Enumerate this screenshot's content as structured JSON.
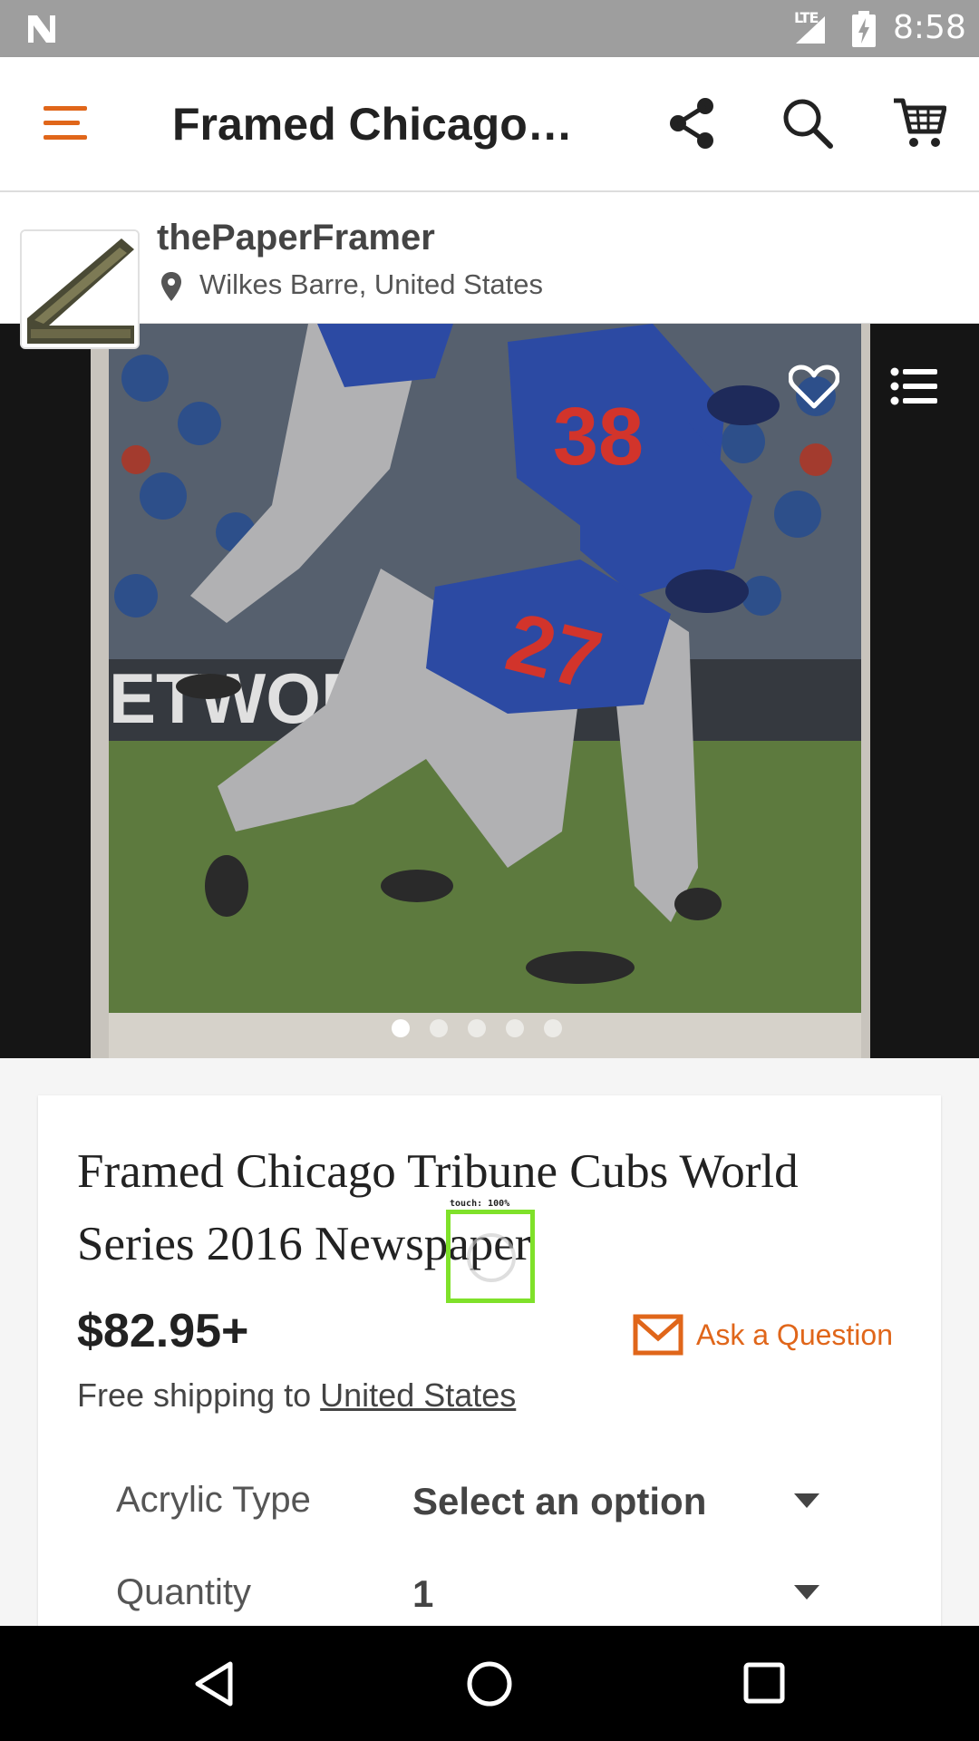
{
  "status_bar": {
    "time": "8:58",
    "network": "LTE"
  },
  "app_bar": {
    "title": "Framed Chicago…",
    "icons": [
      "menu-icon",
      "share-icon",
      "search-icon",
      "cart-icon"
    ],
    "accent_color": "#e0661a"
  },
  "shop": {
    "name": "thePaperFramer",
    "location": "Wilkes Barre, United States"
  },
  "gallery": {
    "photo_text": "ETWORK",
    "jersey_numbers": [
      "38",
      "27"
    ],
    "image_count": 5,
    "active_index": 0
  },
  "product": {
    "title": "Framed Chicago Tribune Cubs World Series 2016  Newspaper",
    "price": "$82.95+",
    "ask_label": "Ask a Question",
    "shipping_prefix": "Free shipping to ",
    "shipping_destination": "United States"
  },
  "options": [
    {
      "label": "Acrylic Type",
      "value": "Select an option"
    },
    {
      "label": "Quantity",
      "value": "1"
    }
  ],
  "touch_overlay": {
    "label": "touch: 100%"
  }
}
